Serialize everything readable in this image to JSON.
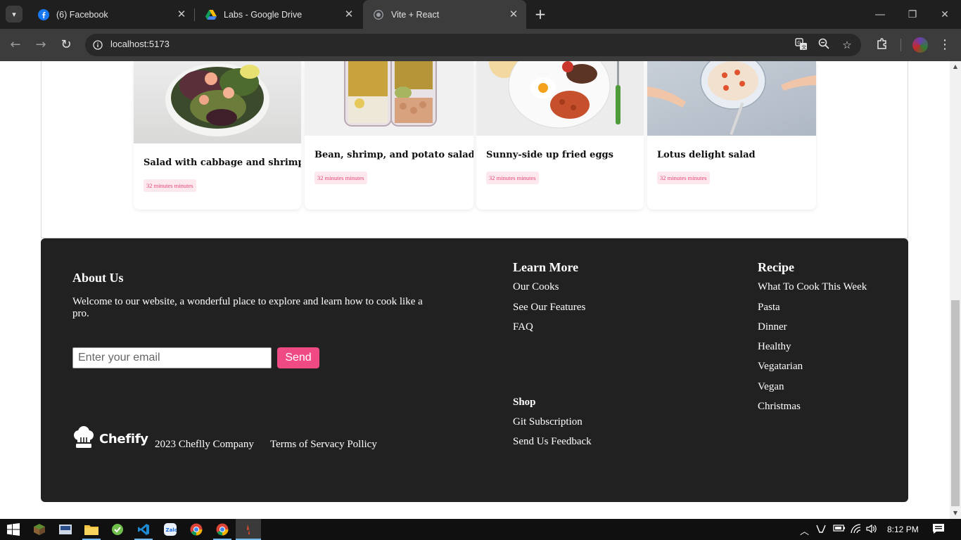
{
  "browser": {
    "tabs": [
      {
        "title": "(6) Facebook",
        "icon": "facebook-icon",
        "active": false
      },
      {
        "title": "Labs - Google Drive",
        "icon": "google-drive-icon",
        "active": false
      },
      {
        "title": "Vite + React",
        "icon": "globe-icon",
        "active": true
      }
    ],
    "url": "localhost:5173"
  },
  "recipes": [
    {
      "title": "Salad with cabbage and shrimp",
      "time": "32 minutes minutes"
    },
    {
      "title": "Bean, shrimp, and potato salad",
      "time": "32 minutes minutes"
    },
    {
      "title": "Sunny-side up fried eggs",
      "time": "32 minutes minutes"
    },
    {
      "title": "Lotus delight salad",
      "time": "32 minutes minutes"
    }
  ],
  "footer": {
    "about_title": "About Us",
    "about_text": "Welcome to our website, a wonderful place to explore and learn how to cook like a pro.",
    "email_placeholder": "Enter your email",
    "send_label": "Send",
    "logo_text": "Chefify",
    "copyright": "2023 Cheflly Company",
    "terms": "Terms of Servacy Pollicy",
    "learn_more": {
      "title": "Learn More",
      "links": [
        "Our Cooks",
        "See Our Features",
        "FAQ"
      ]
    },
    "shop": {
      "title": "Shop",
      "links": [
        "Git Subscription",
        "Send Us Feedback"
      ]
    },
    "recipe": {
      "title": "Recipe",
      "links": [
        "What To Cook This Week",
        "Pasta",
        "Dinner",
        "Healthy",
        "Vegatarian",
        "Vegan",
        "Christmas"
      ]
    },
    "accent_color": "#f04a85",
    "background_color": "#222122"
  },
  "taskbar": {
    "time": "8:12 PM"
  }
}
